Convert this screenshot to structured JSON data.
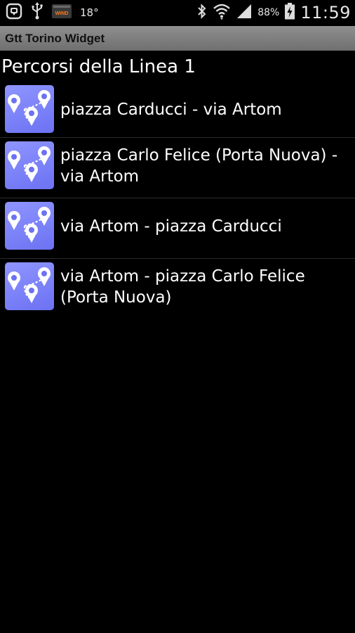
{
  "status_bar": {
    "icons_left": [
      "chat-icon",
      "usb-icon",
      "wind-logo"
    ],
    "carrier_logo_text": "WIND",
    "temperature": "18°",
    "icons_right": [
      "bluetooth-icon",
      "wifi-icon",
      "signal-icon",
      "battery-icon"
    ],
    "battery_percent": "88%",
    "time": "11:59"
  },
  "app": {
    "title": "Gtt Torino Widget"
  },
  "page": {
    "heading": "Percorsi della Linea 1"
  },
  "routes": [
    {
      "label": "piazza Carducci - via Artom",
      "icon": "route-map-icon"
    },
    {
      "label": "piazza Carlo Felice (Porta Nuova) - via Artom",
      "icon": "route-map-icon"
    },
    {
      "label": "via Artom - piazza Carducci",
      "icon": "route-map-icon"
    },
    {
      "label": "via Artom - piazza Carlo Felice (Porta Nuova)",
      "icon": "route-map-icon"
    }
  ],
  "colors": {
    "background": "#000000",
    "title_bar": "#7f7f7f",
    "icon_tile": "#7c82f8",
    "text": "#ffffff"
  }
}
